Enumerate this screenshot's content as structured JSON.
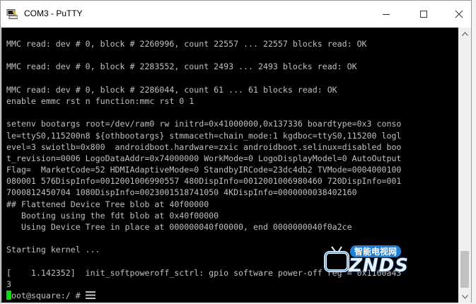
{
  "window": {
    "title": "COM3 - PuTTY",
    "icon": "putty-icon"
  },
  "controls": {
    "minimize_icon": "minimize-icon",
    "maximize_icon": "maximize-icon",
    "close_icon": "close-icon"
  },
  "terminal": {
    "lines": [
      "MMC read: dev # 0, block # 2260996, count 22557 ... 22557 blocks read: OK",
      "",
      "MMC read: dev # 0, block # 2283552, count 2493 ... 2493 blocks read: OK",
      "",
      "MMC read: dev # 0, block # 2286044, count 61 ... 61 blocks read: OK",
      "enable emmc rst n function:mmc rst 0 1",
      "",
      "setenv bootargs root=/dev/ram0 rw initrd=0x41000000,0x137336 boardtype=0x3 conso",
      "le=ttyS0,115200n8 ${othbootargs} stmmaceth=chain_mode:1 kgdboc=ttyS0,115200 logl",
      "evel=3 swiotlb=0x800  androidboot.hardware=zxic androidboot.selinux=disabled boo",
      "t_revision=0006 LogoDataAddr=0x74000000 WorkMode=0 LogoDisplayModel=0 AutoOutput",
      "Flag=  MarketCode=52 HDMIAdaptiveMode=0 StandbyIRCode=23dc4db2 TVMode=0004000100",
      "080001 576DispInfo=0012001006990557 480DispInfo=0012001006980460 720DispInfo=001",
      "7000812450704 1080DispInfo=0023001518741050 4KDispInfo=0000000038402160",
      "## Flattened Device Tree blob at 40f00000",
      "   Booting using the fdt blob at 0x40f00000",
      "   Using Device Tree in place at 000000040f00000, end 0000000040f0a2ce",
      "",
      "Starting kernel ...",
      "",
      "[    1.142352]  init_softpoweroff_sctrl: gpio software power-off reg = 0x1160a43",
      "3"
    ],
    "prompt": "root@square:/ # "
  },
  "watermark": {
    "cn": "智能电视网",
    "en": "ZNDS",
    "icon": "tv-logo-icon"
  },
  "colors": {
    "terminal_bg": "#000000",
    "terminal_fg": "#c0c0c0",
    "cursor": "#00e000",
    "watermark_blue": "#1f7fd6"
  }
}
